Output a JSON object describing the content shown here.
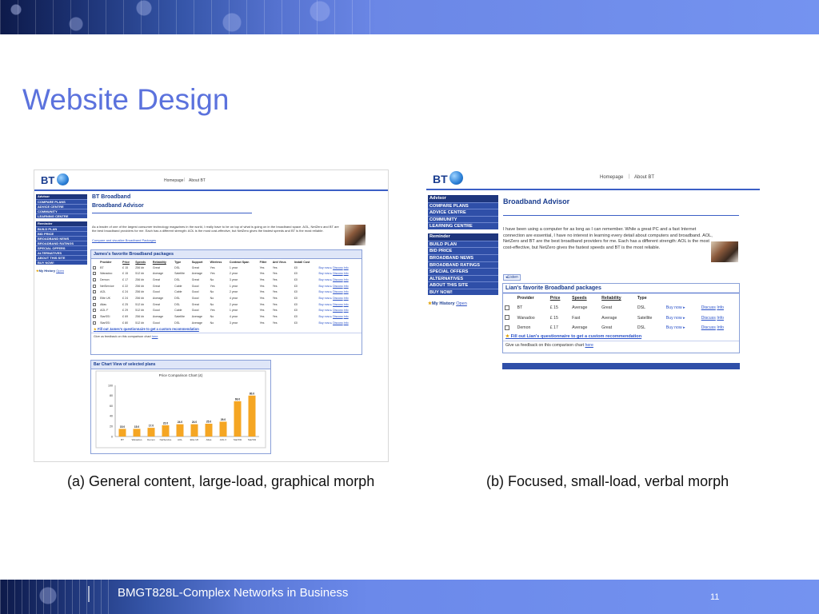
{
  "slide": {
    "title": "Website Design",
    "footer": "BMGT828L-Complex Networks in Business",
    "page_number": "11"
  },
  "caption_a": "(a)  General content, large-load, graphical morph",
  "caption_b": "(b) Focused, small-load, verbal morph",
  "shot_a": {
    "logo": "BT",
    "nav_homepage": "Homepage",
    "nav_about": "About BT",
    "sidebar_advisor_head": "Advisor",
    "sidebar_advisor_items": [
      "COMPARE PLANS",
      "ADVICE CENTRE",
      "COMMUNITY",
      "LEARNING CENTRE"
    ],
    "sidebar_reminder_head": "Reminder",
    "sidebar_reminder_items": [
      "BUILD PLAN",
      "BID PRICE",
      "BROADBAND NEWS",
      "BROADBAND RATINGS",
      "SPECIAL OFFERS",
      "ALTERNATIVES",
      "ABOUT THIS SITE",
      "BUY NOW!"
    ],
    "my_history": "My History",
    "my_history_link": "Open",
    "heading1": "BT Broadband",
    "heading2": "Broadband Advisor",
    "intro": "As a leader of one of the largest consumer technology magazines in the world, I really have to be on top of what is going on in the broadband space. AOL, NetZero and BT are the best broadband providers for me. Each has a different strength: AOL is the most cost-effective, but NetZero gives the fastest speeds and BT is the most reliable.",
    "intro_link": "Compare and visualize Broadband Packages",
    "panel_title": "James's favorite Broadband packages",
    "columns": [
      "Provider",
      "Price",
      "Speeds",
      "Reliability",
      "Type",
      "Support",
      "Wireless",
      "Contract Span",
      "Filter",
      "Anti Virus",
      "Install Cost",
      ""
    ],
    "rows": [
      [
        "BT",
        "£ 15",
        "256 kb",
        "Great",
        "DSL",
        "Great",
        "Yes",
        "1 year",
        "Yes",
        "Yes",
        "£0"
      ],
      [
        "Wanadoo",
        "£ 15",
        "512 kb",
        "Average",
        "Satellite",
        "Average",
        "Yes",
        "2 year",
        "Yes",
        "Yes",
        "£0"
      ],
      [
        "Demon",
        "£ 17",
        "256 kb",
        "Great",
        "DSL",
        "Great",
        "No",
        "3 year",
        "Yes",
        "Yes",
        "£0"
      ],
      [
        "NetService",
        "£ 22",
        "256 kb",
        "Great",
        "Cable",
        "Good",
        "Yes",
        "1 year",
        "Yes",
        "Yes",
        "£0"
      ],
      [
        "AOL",
        "£ 24",
        "256 kb",
        "Good",
        "Cable",
        "Good",
        "No",
        "2 year",
        "Yes",
        "Yes",
        "£0"
      ],
      [
        "Elite UK",
        "£ 24",
        "256 kb",
        "Average",
        "DSL",
        "Good",
        "No",
        "4 year",
        "Yes",
        "Yes",
        "£0"
      ],
      [
        "Atlas",
        "£ 25",
        "512 kb",
        "Great",
        "DSL",
        "Great",
        "No",
        "2 year",
        "Yes",
        "Yes",
        "£0"
      ],
      [
        "AOL F",
        "£ 29",
        "512 kb",
        "Good",
        "Cable",
        "Good",
        "Yes",
        "1 year",
        "Yes",
        "Yes",
        "£0"
      ],
      [
        "StarSSI",
        "£ 69",
        "256 kb",
        "Average",
        "Satellite",
        "Average",
        "No",
        "4 year",
        "Yes",
        "Yes",
        "£0"
      ],
      [
        "StarSSI",
        "£ 80",
        "512 kb",
        "Good",
        "DSL",
        "Average",
        "No",
        "3 year",
        "Yes",
        "Yes",
        "£0"
      ]
    ],
    "buy_label": "Buy now ▸",
    "discuss_label": "Discuss",
    "info_label": "Info",
    "questionnaire": "Fill out James's questionnaire to get a custom recommendation",
    "feedback": "Give us feedback on this comparison chart",
    "feedback_link": "here",
    "chart_panel_title": "Bar Chart View of selected plans",
    "chart_inner_title": "Price Comparison Chart (£)"
  },
  "chart_data": {
    "type": "bar",
    "title": "Price Comparison Chart (£)",
    "categories": [
      "BT",
      "Wanadoo",
      "Demon",
      "NetService",
      "AOL",
      "Elite UK",
      "Atlas",
      "AOL F",
      "StarSSI",
      "StarSSI"
    ],
    "values": [
      15.0,
      15.0,
      17.0,
      22.0,
      24.0,
      24.0,
      25.0,
      29.0,
      69.0,
      80.0
    ],
    "value_labels": [
      "15.0",
      "15.0",
      "17.0",
      "22.0",
      "24.0",
      "24.0",
      "25.0",
      "29.0",
      "69.0",
      "80.0"
    ],
    "ylim": [
      0,
      100
    ],
    "yticks": [
      "0",
      "20",
      "40",
      "60",
      "80",
      "100"
    ],
    "bar_color": "#f5a623",
    "grid": false
  },
  "shot_b": {
    "logo": "BT",
    "nav_homepage": "Homepage",
    "nav_about": "About BT",
    "sidebar_advisor_head": "Advisor",
    "sidebar_advisor_items": [
      "COMPARE PLANS",
      "ADVICE CENTRE",
      "COMMUNITY",
      "LEARNING CENTRE"
    ],
    "sidebar_reminder_head": "Reminder",
    "sidebar_reminder_items": [
      "BUILD PLAN",
      "BID PRICE",
      "BROADBAND NEWS",
      "BROADBAND RATINGS",
      "SPECIAL OFFERS",
      "ALTERNATIVES",
      "ABOUT THIS SITE",
      "BUY NOW!"
    ],
    "my_history": "My History",
    "my_history_link": "Open",
    "heading": "Broadband Advisor",
    "intro": "I have been using a computer for as long as I can remember. While a great PC and a fast Internet connection are essential, I have no interest in learning every detail about computers and broadband. AOL, NetZero and BT are the best broadband providers for me. Each has a different strength: AOL is the most cost-effective, but NetZero gives the fastest speeds and BT is the most reliable.",
    "listen": "Listen",
    "panel_title": "Lian's favorite Broadband packages",
    "columns": [
      "",
      "Provider",
      "Price",
      "Speeds",
      "Reliability",
      "Type",
      "",
      ""
    ],
    "rows": [
      [
        "BT",
        "£ 15",
        "Average",
        "Great",
        "DSL"
      ],
      [
        "Wanadoo",
        "£ 15",
        "Fast",
        "Average",
        "Satellite"
      ],
      [
        "Demon",
        "£ 17",
        "Average",
        "Great",
        "DSL"
      ]
    ],
    "buy_label": "Buy now ▸",
    "discuss_label": "Discuss",
    "info_label": "Info",
    "questionnaire": "Fill out Lian's questionnaire to get a custom recommendation",
    "feedback": "Give us feedback on this comparison chart",
    "feedback_link": "here"
  },
  "colors": {
    "title": "#5b72dd",
    "bt_blue": "#2f4fa8",
    "bar_gradient_start": "#0d1a4a",
    "bar_gradient_end": "#7493f0"
  }
}
